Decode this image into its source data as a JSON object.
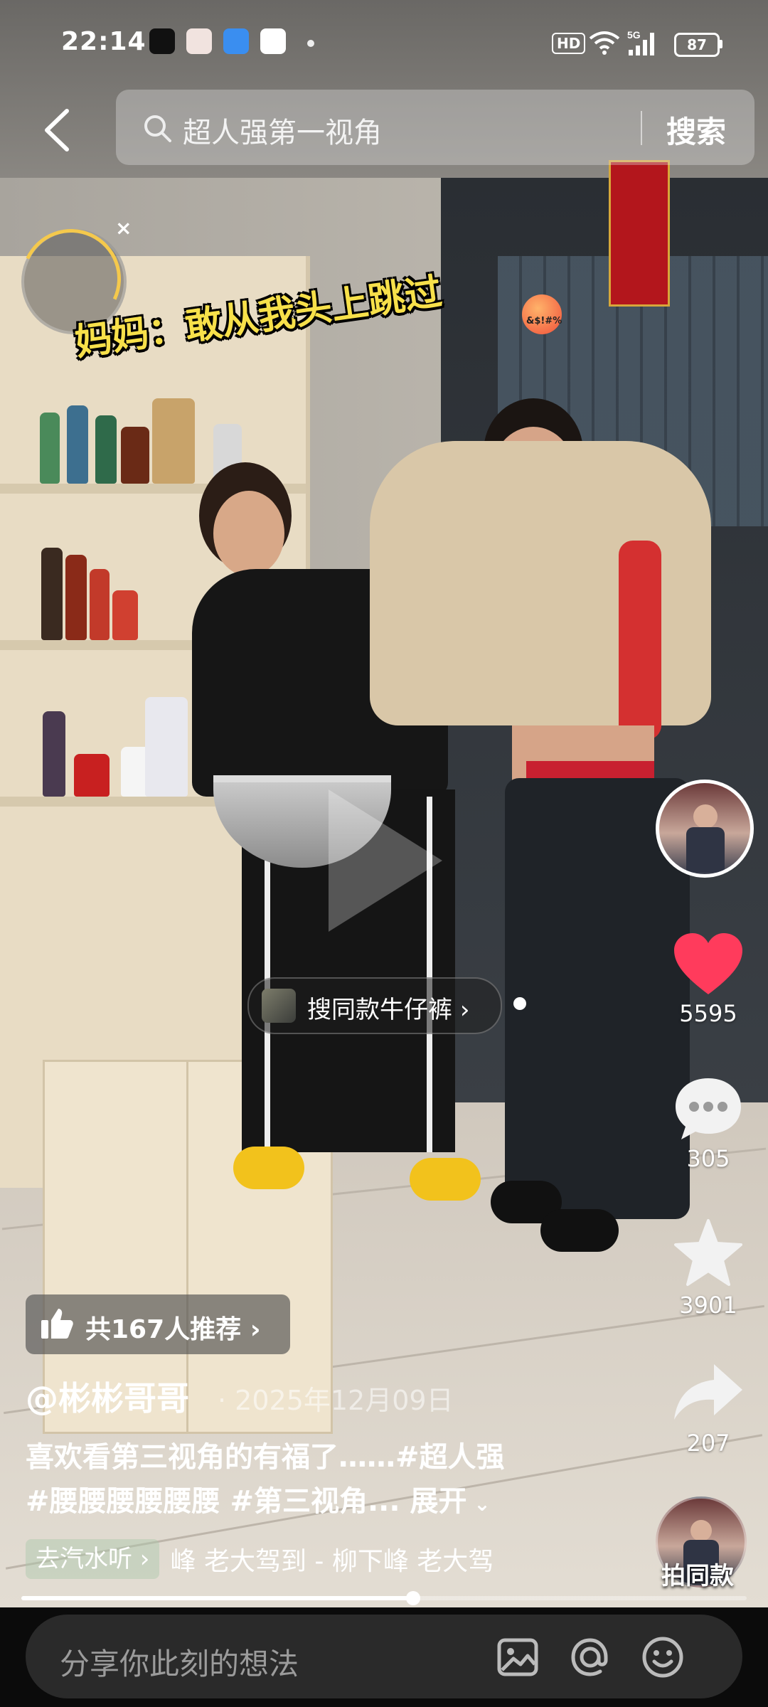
{
  "status_bar": {
    "time": "22:14",
    "hd": "HD",
    "network": "5G",
    "battery": "87"
  },
  "search": {
    "query": "超人强第一视角",
    "button": "搜索"
  },
  "video": {
    "caption": "妈妈：敢从我头上跳过",
    "emoji_text": "&$!#%",
    "product_label": "搜同款牛仔裤",
    "progress": 0.54
  },
  "actions": {
    "likes": "5595",
    "comments": "305",
    "favorites": "3901",
    "shares": "207",
    "same_label": "拍同款"
  },
  "info": {
    "recommend": "共167人推荐",
    "author": "@彬彬哥哥",
    "date": "· 2025年12月09日",
    "desc_line1": "喜欢看第三视角的有福了……",
    "tag1": "#超人强",
    "tags_line2": "#腰腰腰腰腰腰 #第三视角...",
    "expand": "展开",
    "music_tag": "去汽水听",
    "music_scroll": "峰    老大驾到 - 柳下峰    老大驾"
  },
  "comment_bar": {
    "placeholder": "分享你此刻的想法"
  },
  "colors": {
    "like_red": "#ff3b5c",
    "caption_yellow": "#f7e04a"
  },
  "icons": [
    "back-icon",
    "search-icon",
    "heart-icon",
    "comment-icon",
    "star-icon",
    "share-icon",
    "image-icon",
    "at-icon",
    "emoji-icon",
    "thumb-up-icon"
  ]
}
